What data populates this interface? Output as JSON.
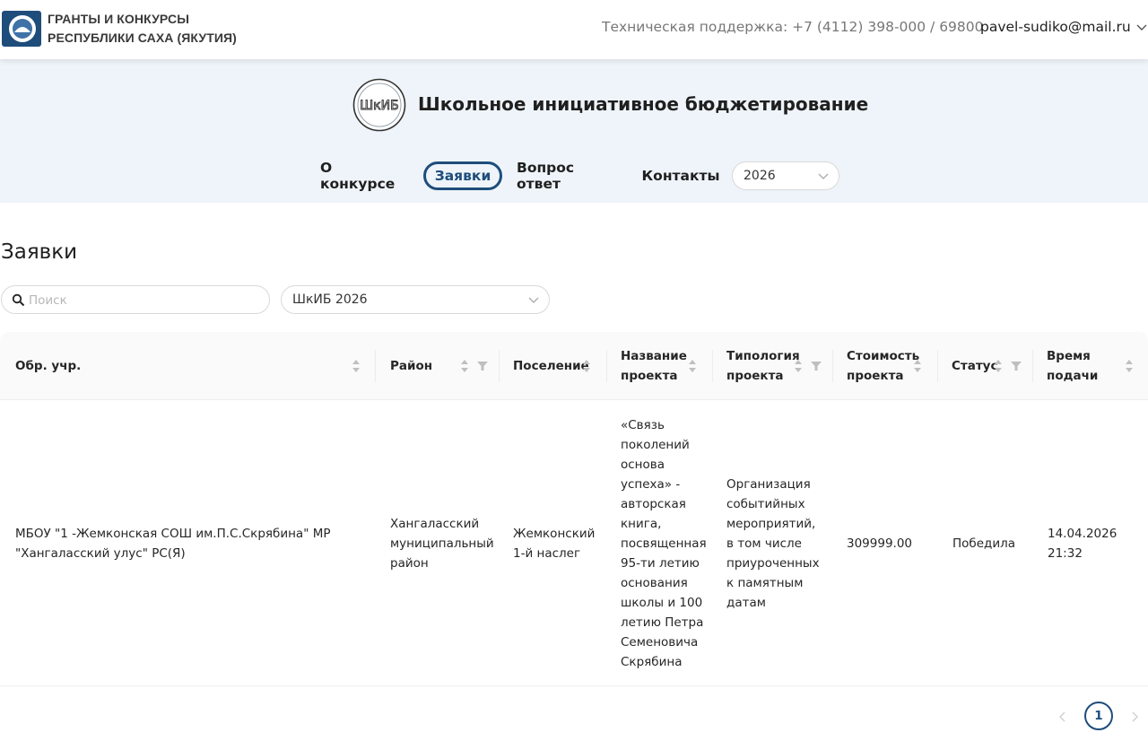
{
  "header": {
    "brand_line1": "ГРАНТЫ И КОНКУРСЫ",
    "brand_line2": "РЕСПУБЛИКИ САХА (ЯКУТИЯ)",
    "support": "Техническая поддержка: +7 (4112) 398-000 / 69800",
    "user_email": "pavel-sudiko@mail.ru"
  },
  "contest": {
    "logo_text": "ШкИБ",
    "title": "Школьное инициативное бюджетирование"
  },
  "nav": {
    "items": [
      {
        "label": "О конкурсе"
      },
      {
        "label": "Заявки",
        "active": true
      },
      {
        "label": "Вопрос ответ"
      },
      {
        "label": "Контакты"
      }
    ],
    "year": "2026"
  },
  "page": {
    "title": "Заявки"
  },
  "filters": {
    "search_placeholder": "Поиск",
    "contest_value": "ШкИБ 2026"
  },
  "table": {
    "columns": [
      {
        "line1": "Обр. учр.",
        "line2": ""
      },
      {
        "line1": "Район",
        "line2": ""
      },
      {
        "line1": "Поселение",
        "line2": ""
      },
      {
        "line1": "Название",
        "line2": "проекта"
      },
      {
        "line1": "Типология",
        "line2": "проекта"
      },
      {
        "line1": "Стоимость",
        "line2": "проекта"
      },
      {
        "line1": "Статус",
        "line2": ""
      },
      {
        "line1": "Время",
        "line2": "подачи"
      }
    ],
    "rows": [
      {
        "org": [
          "МБОУ \"1 -Жемконская СОШ им.П.С.Скрябина\" МР",
          "\"Хангаласский улус\" РС(Я)"
        ],
        "district": [
          "Хангаласский",
          "муниципальный",
          "район"
        ],
        "settlement": [
          "Жемконский",
          "1-й наслег"
        ],
        "project": [
          "«Связь",
          "поколений",
          "основа",
          "успеха» -",
          "авторская",
          "книга,",
          "посвященная",
          "95-ти летию",
          "основания",
          "школы и 100",
          "летию Петра",
          "Семеновича",
          "Скрябина"
        ],
        "typology": [
          "Организация",
          "событийных",
          "мероприятий,",
          "в том числе",
          "приуроченных",
          "к памятным",
          "датам"
        ],
        "cost": "309999.00",
        "status": "Победила",
        "submitted": [
          "14.04.2026",
          "21:32"
        ]
      }
    ]
  },
  "pagination": {
    "current": "1"
  },
  "colors": {
    "accent": "#1e4d7b",
    "hero_bg": "#eef4f9"
  },
  "icons": [
    "yakutia-emblem-icon",
    "chevron-down-icon",
    "search-icon",
    "sort-icon",
    "filter-icon",
    "chevron-left-icon",
    "chevron-right-icon"
  ]
}
